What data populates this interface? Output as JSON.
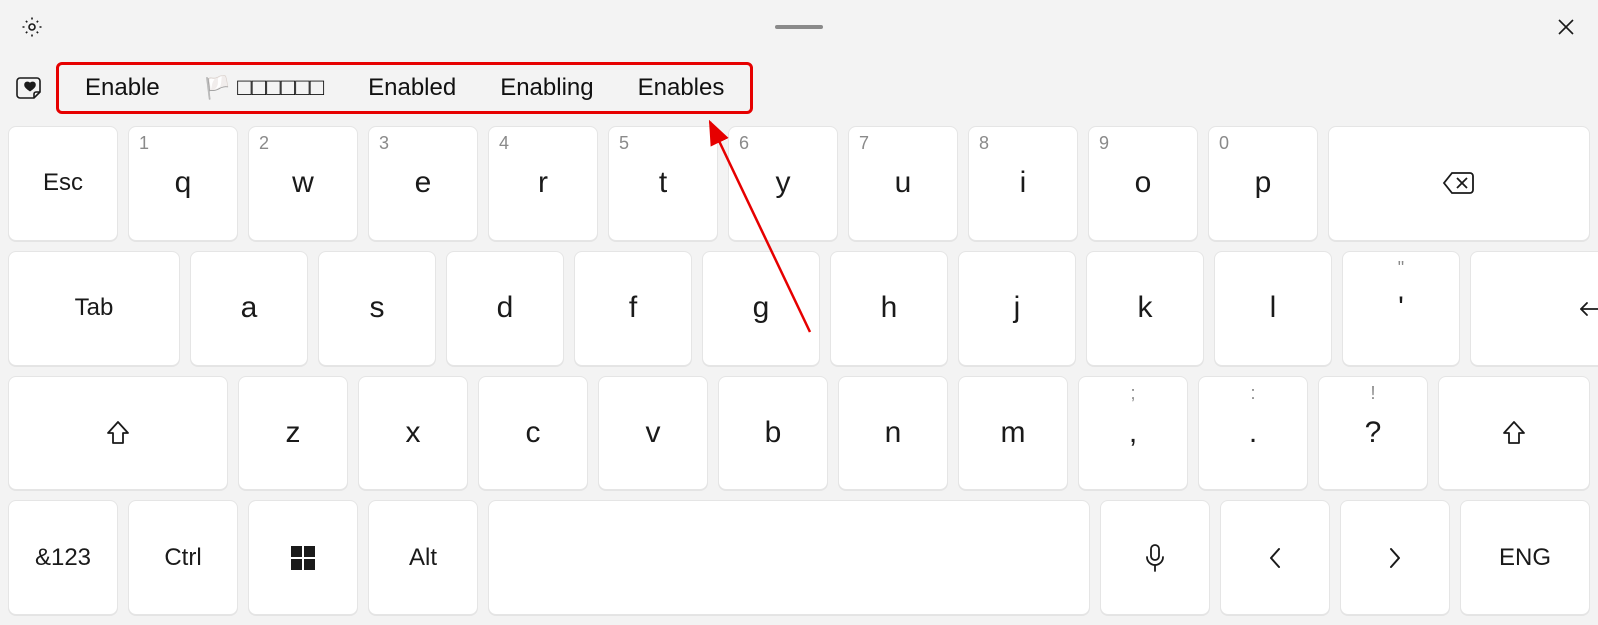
{
  "titlebar": {
    "settings_icon": "gear",
    "close_icon": "close"
  },
  "suggestion_bar": {
    "sticker_icon": "heart-sticker",
    "items": [
      {
        "label": "Enable",
        "emoji": ""
      },
      {
        "label": "□□□□□□",
        "emoji": "🏳️"
      },
      {
        "label": "Enabled",
        "emoji": ""
      },
      {
        "label": "Enabling",
        "emoji": ""
      },
      {
        "label": "Enables",
        "emoji": ""
      }
    ]
  },
  "annotation": {
    "highlight_color": "#e60000",
    "arrow_from": "suggestion-bar",
    "arrow_direction": "down-right"
  },
  "keyboard": {
    "row1": {
      "esc": "Esc",
      "keys": [
        {
          "main": "q",
          "hint": "1"
        },
        {
          "main": "w",
          "hint": "2"
        },
        {
          "main": "e",
          "hint": "3"
        },
        {
          "main": "r",
          "hint": "4"
        },
        {
          "main": "t",
          "hint": "5"
        },
        {
          "main": "y",
          "hint": "6"
        },
        {
          "main": "u",
          "hint": "7"
        },
        {
          "main": "i",
          "hint": "8"
        },
        {
          "main": "o",
          "hint": "9"
        },
        {
          "main": "p",
          "hint": "0"
        }
      ],
      "backspace_icon": "backspace"
    },
    "row2": {
      "tab": "Tab",
      "keys": [
        {
          "main": "a"
        },
        {
          "main": "s"
        },
        {
          "main": "d"
        },
        {
          "main": "f"
        },
        {
          "main": "g"
        },
        {
          "main": "h"
        },
        {
          "main": "j"
        },
        {
          "main": "k"
        },
        {
          "main": "l"
        },
        {
          "main": "'",
          "hint": "\""
        }
      ],
      "enter_icon": "enter"
    },
    "row3": {
      "shift_left_icon": "shift",
      "keys": [
        {
          "main": "z"
        },
        {
          "main": "x"
        },
        {
          "main": "c"
        },
        {
          "main": "v"
        },
        {
          "main": "b"
        },
        {
          "main": "n"
        },
        {
          "main": "m"
        },
        {
          "main": ",",
          "hint": ";"
        },
        {
          "main": ".",
          "hint": ":"
        },
        {
          "main": "?",
          "hint": "!"
        }
      ],
      "shift_right_icon": "shift"
    },
    "row4": {
      "numsym": "&123",
      "ctrl": "Ctrl",
      "win_icon": "windows",
      "alt": "Alt",
      "space": " ",
      "mic_icon": "microphone",
      "left_icon": "chevron-left",
      "right_icon": "chevron-right",
      "lang": "ENG"
    }
  }
}
